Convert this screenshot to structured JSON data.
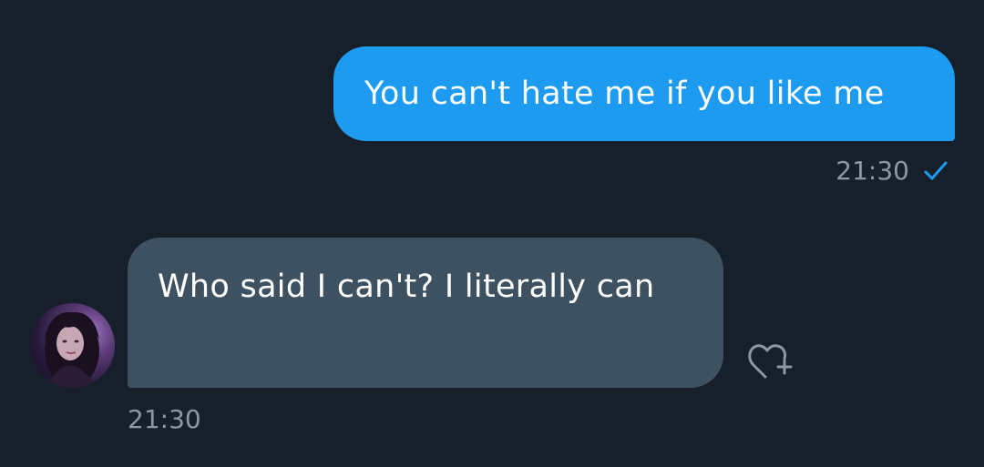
{
  "conversation": {
    "messages": [
      {
        "direction": "outgoing",
        "text": "You can't hate me if you like me",
        "time": "21:30",
        "status_icon": "check-icon"
      },
      {
        "direction": "incoming",
        "text": "Who said I can't? I literally can",
        "time": "21:30",
        "sender_avatar_icon": "avatar",
        "reaction_icon": "heart-plus-icon"
      }
    ]
  },
  "colors": {
    "background": "#17202a",
    "outgoing_bubble": "#1d9bf0",
    "incoming_bubble": "#3d5160",
    "timestamp": "#8b98a5",
    "check": "#1d9bf0"
  }
}
